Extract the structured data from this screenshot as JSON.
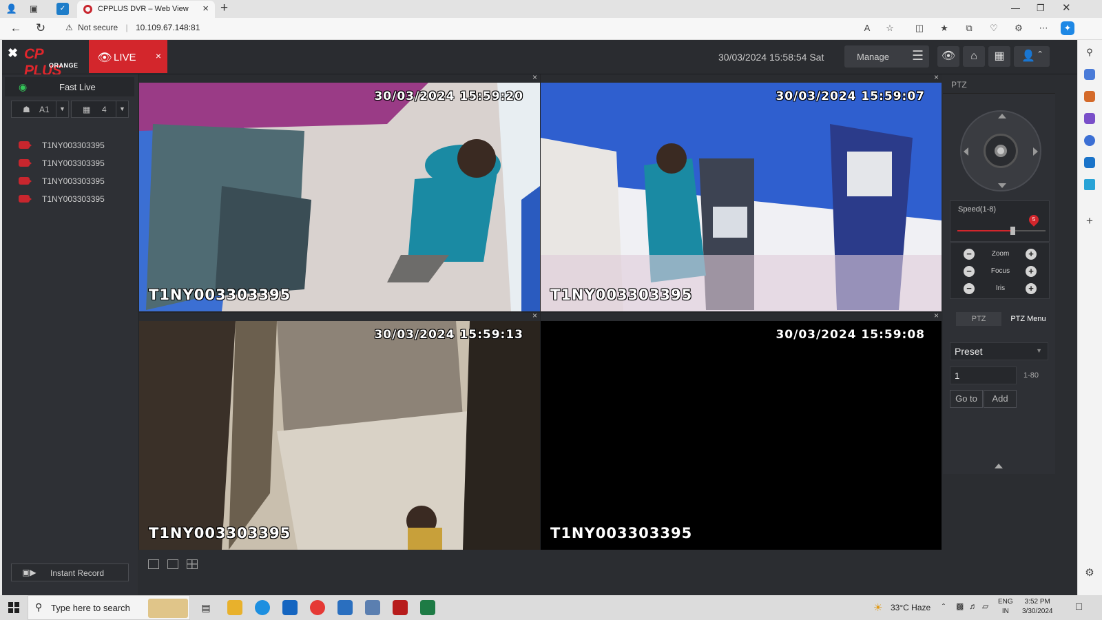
{
  "browser": {
    "tab_title": "CPPLUS DVR – Web View",
    "tab_close": "×",
    "new_tab": "+",
    "security_label": "Not secure",
    "url": "10.109.67.148:81"
  },
  "app": {
    "logo": {
      "brand": "CP PLUS",
      "sub": "ORANGE"
    },
    "live_tab": {
      "label": "LIVE",
      "close": "×"
    },
    "datetime": "30/03/2024 15:58:54 Sat",
    "manage_label": "Manage"
  },
  "sidebar": {
    "fast_live": "Fast Live",
    "channel_select": "A1",
    "layout_select": "4",
    "cameras": [
      {
        "label": "T1NY003303395"
      },
      {
        "label": "T1NY003303395"
      },
      {
        "label": "T1NY003303395"
      },
      {
        "label": "T1NY003303395"
      }
    ],
    "instant_record": "Instant Record"
  },
  "grid": {
    "cells": [
      {
        "timestamp": "30/03/2024 15:59:20",
        "camera": "T1NY003303395"
      },
      {
        "timestamp": "30/03/2024 15:59:07",
        "camera": "T1NY003303395"
      },
      {
        "timestamp": "30/03/2024 15:59:13",
        "camera": "T1NY003303395"
      },
      {
        "timestamp": "30/03/2024 15:59:08",
        "camera": "T1NY003303395"
      }
    ]
  },
  "ptz": {
    "title": "PTZ",
    "speed_label": "Speed(1-8)",
    "speed_value": "5",
    "speed_level": 5,
    "speed_max": 8,
    "zoom_label": "Zoom",
    "focus_label": "Focus",
    "iris_label": "Iris",
    "tab_ptz": "PTZ",
    "tab_menu": "PTZ Menu",
    "preset_label": "Preset",
    "preset_number": "1",
    "preset_range": "1-80",
    "goto_label": "Go to",
    "add_label": "Add"
  },
  "taskbar": {
    "search_placeholder": "Type here to search",
    "weather": "33°C  Haze",
    "lang": "ENG",
    "region": "IN",
    "time": "3:52 PM",
    "date": "3/30/2024"
  },
  "colors": {
    "brand_red": "#d3262c",
    "active_green": "#43c15a",
    "panel_dark": "#2b2d31"
  }
}
